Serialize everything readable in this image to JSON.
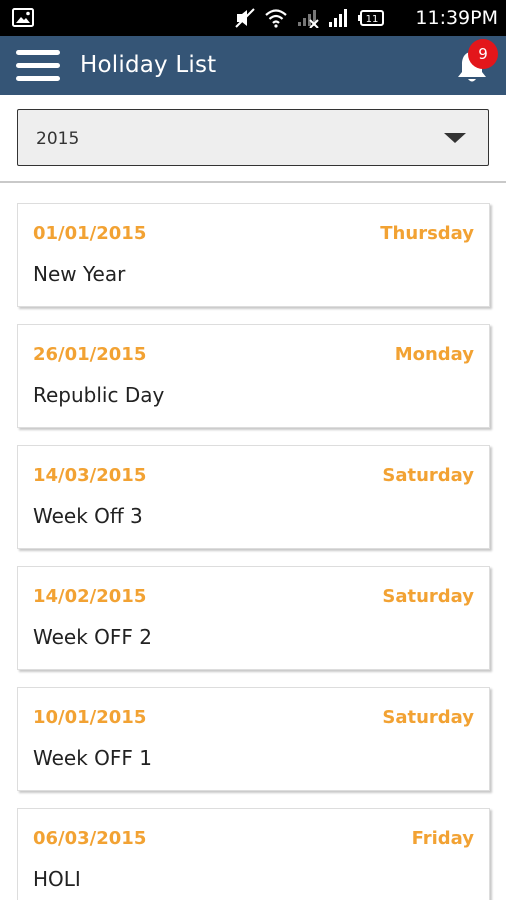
{
  "status_bar": {
    "time": "11:39PM",
    "battery": "11"
  },
  "app_bar": {
    "title": "Holiday List",
    "notification_count": "9"
  },
  "year_selector": {
    "selected": "2015"
  },
  "holidays": [
    {
      "date": "01/01/2015",
      "day": "Thursday",
      "name": "New Year"
    },
    {
      "date": "26/01/2015",
      "day": "Monday",
      "name": "Republic Day"
    },
    {
      "date": "14/03/2015",
      "day": "Saturday",
      "name": "Week Off 3"
    },
    {
      "date": "14/02/2015",
      "day": "Saturday",
      "name": "Week OFF 2"
    },
    {
      "date": "10/01/2015",
      "day": "Saturday",
      "name": "Week OFF 1"
    },
    {
      "date": "06/03/2015",
      "day": "Friday",
      "name": "HOLI"
    }
  ],
  "colors": {
    "app_bar": "#355576",
    "accent": "#f2a233",
    "badge": "#e3161b"
  },
  "icons": [
    "gallery-icon",
    "mute-icon",
    "wifi-icon",
    "no-signal-icon",
    "signal-icon",
    "battery-icon",
    "menu-icon",
    "bell-icon",
    "dropdown-arrow-icon"
  ]
}
